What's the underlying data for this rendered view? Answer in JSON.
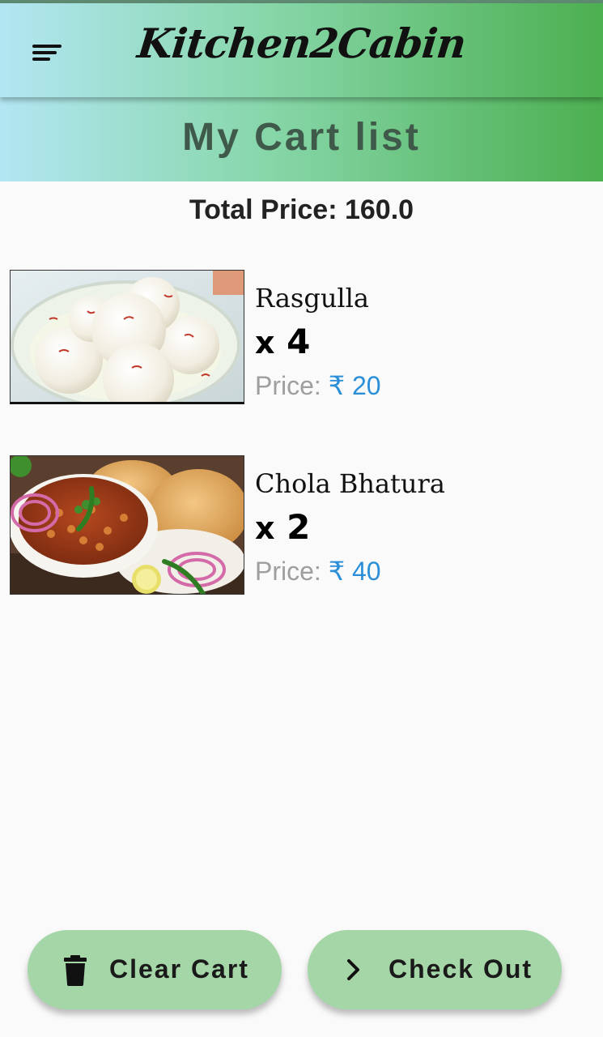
{
  "app_bar": {
    "title": "Kitchen2Cabin",
    "menu_icon": "sort-menu-icon"
  },
  "header": {
    "title": "My Cart list"
  },
  "cart": {
    "total_label": "Total Price: 160.0",
    "items": [
      {
        "name": "Rasgulla",
        "qty_prefix": "x",
        "qty": "4",
        "price_label": "Price:",
        "price_value": "₹ 20",
        "image": "rasgulla-photo"
      },
      {
        "name": "Chola Bhatura",
        "qty_prefix": "x",
        "qty": "2",
        "price_label": "Price:",
        "price_value": "₹ 40",
        "image": "chola-bhatura-photo"
      }
    ]
  },
  "actions": {
    "clear_label": "Clear Cart",
    "clear_icon": "trash-icon",
    "checkout_label": "Check Out",
    "checkout_icon": "chevron-right-icon"
  },
  "colors": {
    "gradient_start": "#b3e6f3",
    "gradient_end": "#4caf50",
    "button_bg": "#a5d6a7",
    "price_accent": "#2a8fd8"
  }
}
